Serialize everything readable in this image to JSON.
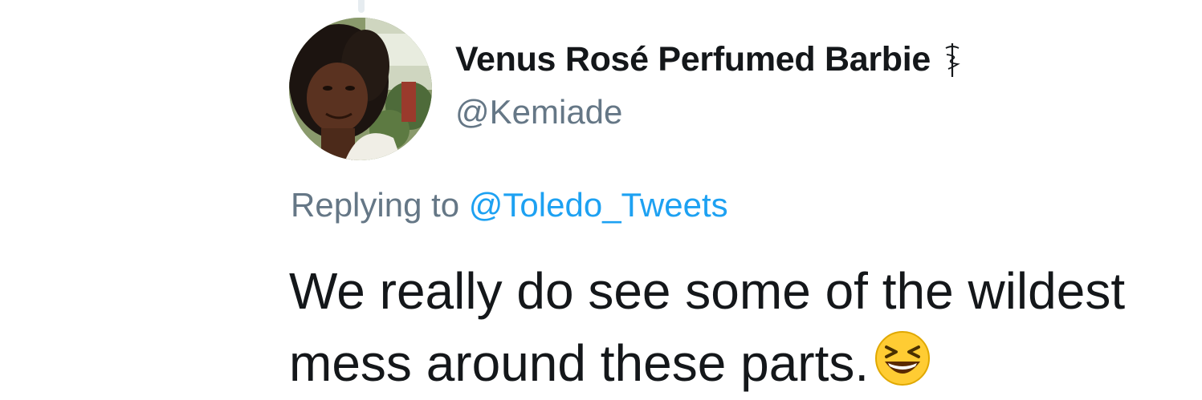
{
  "tweet": {
    "author": {
      "display_name": "Venus Rosé Perfumed Barbie",
      "name_emoji": "staff-of-aesculapius-icon",
      "handle": "@Kemiade"
    },
    "reply_context": {
      "prefix": "Replying to ",
      "mention": "@Toledo_Tweets"
    },
    "text_lines": [
      "We really do see some of the wildest",
      "mess around these parts."
    ],
    "trailing_emoji": "grinning-squinting-face-icon"
  },
  "colors": {
    "name": "#14171a",
    "secondary": "#657786",
    "link": "#1da1f2",
    "thread_line": "#e6ecf0"
  }
}
